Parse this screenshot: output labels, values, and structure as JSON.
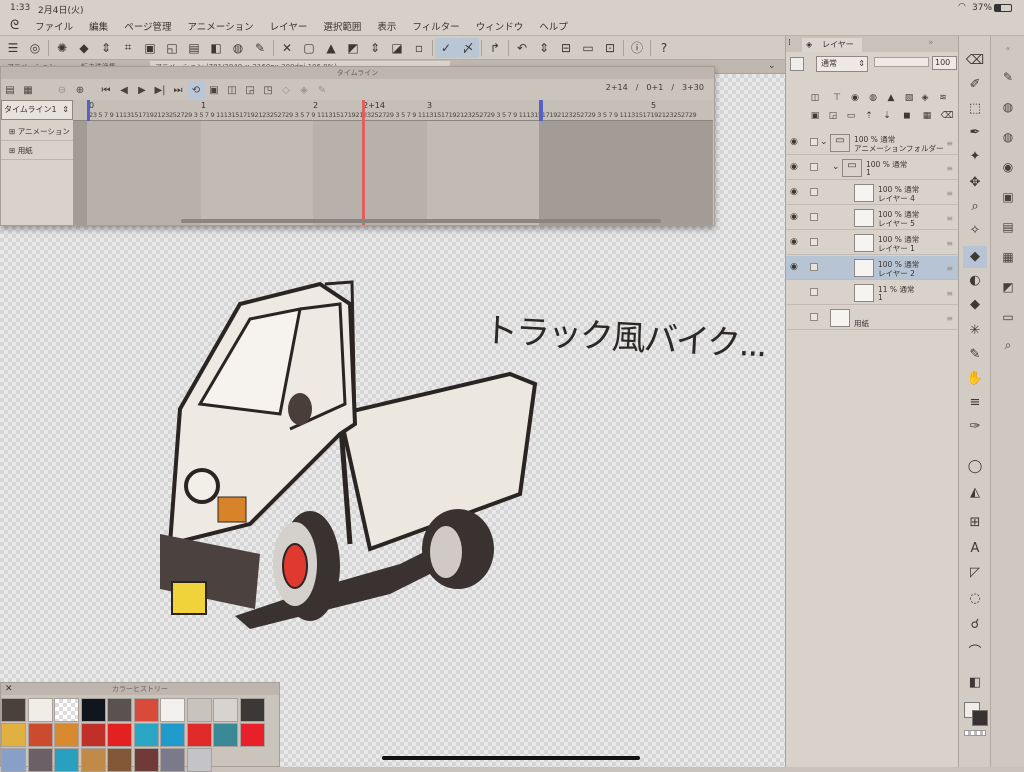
{
  "status": {
    "time": "1:33",
    "date": "2月4日(火)",
    "battery": "37%"
  },
  "menu": [
    "ファイル",
    "編集",
    "ページ管理",
    "アニメーション",
    "レイヤー",
    "選択範囲",
    "表示",
    "フィルター",
    "ウィンドウ",
    "ヘルプ"
  ],
  "tabs": [
    {
      "label": "アニメーション",
      "sel": false
    },
    {
      "label": "転ま洗浄集",
      "sel": false
    },
    {
      "label": "アニメーション (781/3840 × 2160px 300dpi 106.8%)",
      "sel": true
    }
  ],
  "timeline": {
    "title": "タイムライン",
    "track_name": "タイムライン1",
    "rows": [
      "アニメーション",
      "用紙"
    ],
    "counters": [
      "2+14",
      "/",
      "0+1",
      "/",
      "3+30"
    ],
    "ruler_numbers": [
      "0",
      "1",
      "2",
      "2+14",
      "3",
      "5"
    ],
    "ruler_ticks": "23 5 7 9 11131517192123252729 3 5 7 9 11131517192123252729 3 5 7 9 11131517192123252729 3 5 7 9 11131517192123252729 3 5 7 9 11131517192123252729 3 5 7 9 11131517192123252729"
  },
  "canvas": {
    "handwriting": "トラック風バイク..."
  },
  "color_history": {
    "title": "カラーヒストリー",
    "swatches": [
      "#4a403c",
      "#f0ece6",
      "checker",
      "#10161e",
      "#5a5250",
      "#d84a3a",
      "#f2f0ee",
      "#c9c3be",
      "#d7d3cf",
      "#3c3838",
      "#e0b040",
      "#cc4a2e",
      "#d8882e",
      "#c03028",
      "#e42020",
      "#2aa6c4",
      "#209aca",
      "#e02a2a",
      "#3a8896",
      "#e8202a",
      "#88a0c8",
      "#6a6066",
      "#2aa0c0",
      "#c08a4a",
      "#805838",
      "#703a38",
      "#7a7a8a",
      "#c4c4c8"
    ]
  },
  "layer_panel": {
    "tab": "レイヤー",
    "blend": "通常",
    "opacity": "100",
    "layers": [
      {
        "l1": "100 % 通常",
        "l2": "アニメーションフォルダー",
        "indent": 0,
        "folder": true,
        "sel": false,
        "vis": true
      },
      {
        "l1": "100 % 通常",
        "l2": "1",
        "indent": 1,
        "folder": true,
        "sel": false,
        "vis": true
      },
      {
        "l1": "100 % 通常",
        "l2": "レイヤー 4",
        "indent": 2,
        "folder": false,
        "sel": false,
        "vis": true
      },
      {
        "l1": "100 % 通常",
        "l2": "レイヤー 5",
        "indent": 2,
        "folder": false,
        "sel": false,
        "vis": true
      },
      {
        "l1": "100 % 通常",
        "l2": "レイヤー 1",
        "indent": 2,
        "folder": false,
        "sel": false,
        "vis": true
      },
      {
        "l1": "100 % 通常",
        "l2": "レイヤー 2",
        "indent": 2,
        "folder": false,
        "sel": true,
        "vis": true
      },
      {
        "l1": "11 % 通常",
        "l2": "1",
        "indent": 2,
        "folder": false,
        "sel": false,
        "vis": false
      },
      {
        "l1": "",
        "l2": "用紙",
        "indent": 0,
        "folder": false,
        "sel": false,
        "vis": false
      }
    ]
  },
  "colors": {
    "accent": "#b7c4d3",
    "playhead": "#e06060",
    "marker": "#5562c4"
  }
}
